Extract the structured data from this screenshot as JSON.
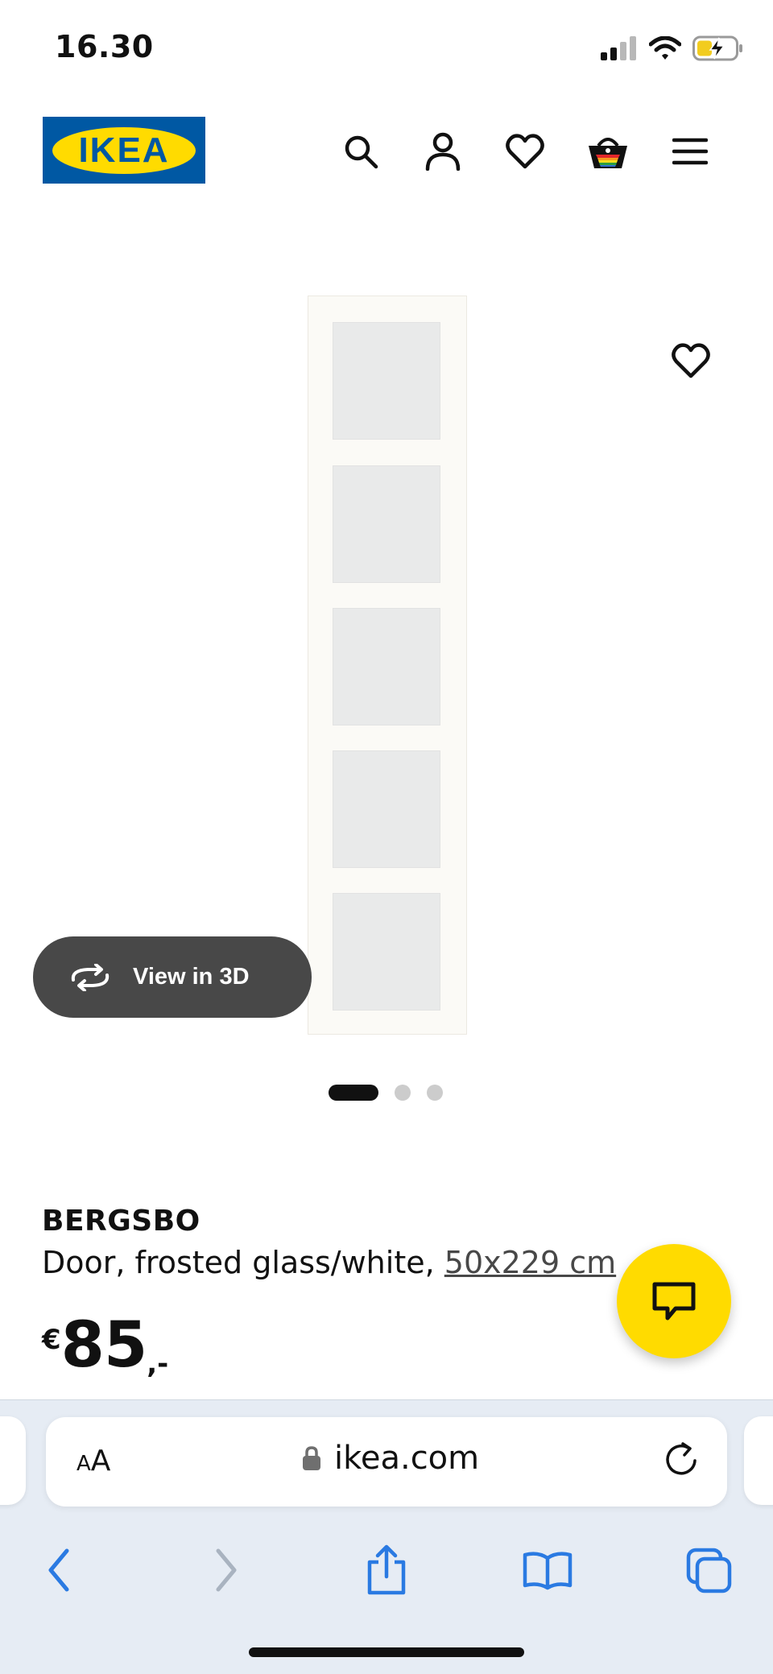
{
  "status_bar": {
    "time": "16.30"
  },
  "header": {
    "logo_text": "IKEA",
    "nav_icons": [
      "search-icon",
      "profile-icon",
      "heart-icon",
      "shopping-bag-icon",
      "menu-icon"
    ]
  },
  "gallery": {
    "view_3d_label": "View in 3D",
    "dots_total": 3,
    "active_dot": 1
  },
  "product": {
    "name": "BERGSBO",
    "description": "Door, frosted glass/white, ",
    "size": "50x229 cm",
    "price_currency": "€",
    "price_value": "85",
    "price_suffix": ",-"
  },
  "browser": {
    "aa_small": "A",
    "aa_large": "A",
    "url": "ikea.com",
    "toolbar_icons": [
      "back-icon",
      "forward-icon",
      "share-icon",
      "bookmarks-icon",
      "tabs-icon"
    ]
  },
  "colors": {
    "ikea_blue": "#0058a3",
    "ikea_yellow": "#ffdb00",
    "view3d_bg": "#484848",
    "safari_blue": "#2a7ae2"
  }
}
